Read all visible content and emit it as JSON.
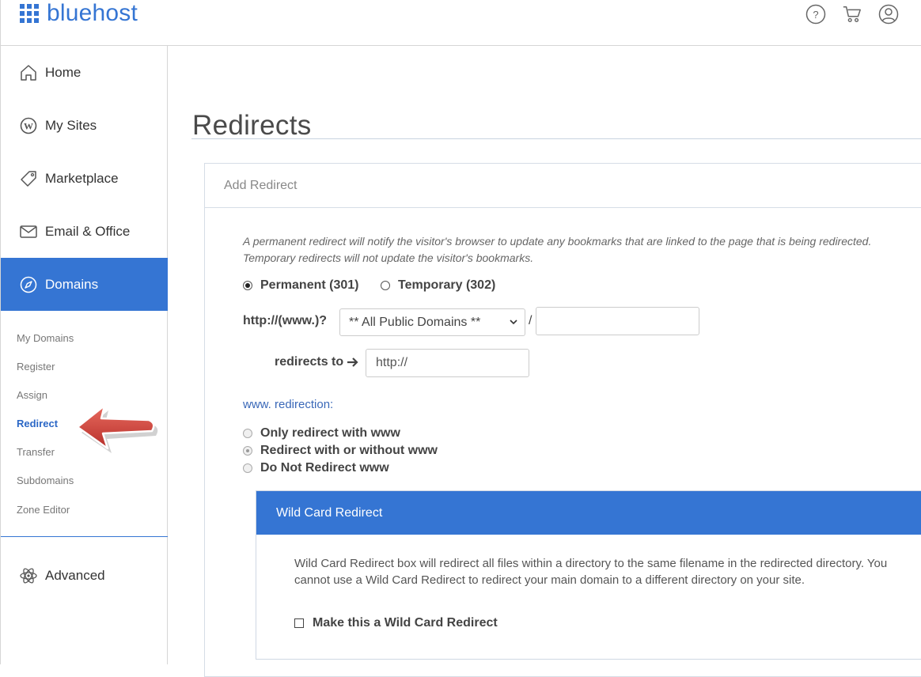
{
  "header": {
    "logo_text": "bluehost",
    "icons": [
      "help-icon",
      "cart-icon",
      "account-icon"
    ]
  },
  "sidebar": {
    "items": [
      {
        "label": "Home",
        "icon": "home-icon"
      },
      {
        "label": "My Sites",
        "icon": "wordpress-icon"
      },
      {
        "label": "Marketplace",
        "icon": "tag-icon"
      },
      {
        "label": "Email & Office",
        "icon": "envelope-icon"
      },
      {
        "label": "Domains",
        "icon": "compass-icon",
        "active": true
      },
      {
        "label": "Advanced",
        "icon": "atom-icon"
      }
    ],
    "sub_items": [
      "My Domains",
      "Register",
      "Assign",
      "Redirect",
      "Transfer",
      "Subdomains",
      "Zone Editor"
    ],
    "active_sub": "Redirect"
  },
  "main": {
    "title": "Redirects",
    "panel": {
      "heading": "Add Redirect",
      "description_line1": "A permanent redirect will notify the visitor's browser to update any bookmarks that are linked to the page that is being redirected.",
      "description_line2": "Temporary redirects will not update the visitor's bookmarks.",
      "type_options": [
        {
          "label": "Permanent (301)",
          "selected": true
        },
        {
          "label": "Temporary (302)",
          "selected": false
        }
      ],
      "url_prefix_label": "http://(www.)?",
      "domain_select": "** All Public Domains **",
      "slash": "/",
      "path_value": "",
      "redirects_to_label": "redirects to",
      "redirects_to_value": "http://",
      "www_label": "www. redirection:",
      "www_options": [
        {
          "label": "Only redirect with www",
          "selected": false
        },
        {
          "label": "Redirect with or without www",
          "selected": true
        },
        {
          "label": "Do Not Redirect www",
          "selected": false
        }
      ],
      "wildcard": {
        "heading": "Wild Card Redirect",
        "description": "Wild Card Redirect box will redirect all files within a directory to the same filename in the redirected directory. You cannot use a Wild Card Redirect to redirect your main domain to a different directory on your site.",
        "checkbox_label": "Make this a Wild Card Redirect",
        "checked": false
      }
    }
  },
  "colors": {
    "brand": "#3575d3",
    "annotation_arrow": "#d9423e"
  }
}
